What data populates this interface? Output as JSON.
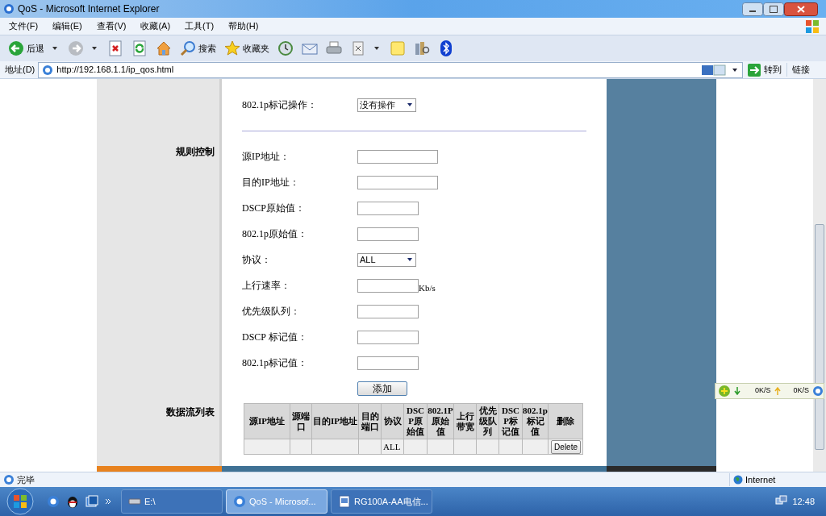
{
  "window": {
    "title": "QoS - Microsoft Internet Explorer"
  },
  "menu": [
    "文件(F)",
    "编辑(E)",
    "查看(V)",
    "收藏(A)",
    "工具(T)",
    "帮助(H)"
  ],
  "toolbar": [
    {
      "kind": "back",
      "label": "后退"
    },
    {
      "kind": "forward"
    },
    {
      "kind": "stop"
    },
    {
      "kind": "refresh"
    },
    {
      "kind": "home"
    },
    {
      "kind": "search",
      "label": "搜索"
    },
    {
      "kind": "favorites",
      "label": "收藏夹"
    },
    {
      "kind": "history"
    },
    {
      "kind": "mail"
    },
    {
      "kind": "print"
    },
    {
      "kind": "edit"
    },
    {
      "kind": "note"
    },
    {
      "kind": "research"
    },
    {
      "kind": "bluetooth"
    }
  ],
  "address_bar": {
    "label": "地址(D)",
    "url": "http://192.168.1.1/ip_qos.html",
    "go": "转到",
    "links": "链接"
  },
  "form": {
    "rows": [
      {
        "kind": "select",
        "label": "802.1p标记操作：",
        "value": "没有操作"
      },
      {
        "kind": "divider"
      },
      {
        "kind": "text",
        "label": "源IP地址：",
        "section": "规则控制",
        "wide": true
      },
      {
        "kind": "text",
        "label": "目的IP地址：",
        "wide": true
      },
      {
        "kind": "text",
        "label": "DSCP原始值："
      },
      {
        "kind": "text",
        "label": "802.1p原始值："
      },
      {
        "kind": "select",
        "label": "协议：",
        "value": "ALL"
      },
      {
        "kind": "text",
        "label": "上行速率：",
        "unit": "Kb/s"
      },
      {
        "kind": "text",
        "label": "优先级队列："
      },
      {
        "kind": "text",
        "label": "DSCP 标记值："
      },
      {
        "kind": "text",
        "label": "802.1p标记值："
      },
      {
        "kind": "button",
        "label": "添加"
      }
    ]
  },
  "flow_table": {
    "section": "数据流列表",
    "columns": [
      "源IP地址",
      "源端口",
      "目的IP地址",
      "目的端口",
      "协议",
      "DSCP原始值",
      "802.1P原始值",
      "上行带宽",
      "优先级队列",
      "DSCP标记值",
      "802.1p标记值",
      "删除"
    ],
    "rows": [
      {
        "protocol": "ALL",
        "delete_button": "Delete"
      }
    ]
  },
  "speed_widget": {
    "download": "0K/S",
    "upload": "0K/S"
  },
  "status_bar": {
    "text": "完毕",
    "zone": "Internet"
  },
  "taskbar": {
    "tasks": [
      {
        "label": "E:\\",
        "selected": false
      },
      {
        "label": "QoS - Microsof...",
        "selected": true
      },
      {
        "label": "RG100A-AA电信...",
        "selected": false
      }
    ],
    "clock": "12:48"
  }
}
